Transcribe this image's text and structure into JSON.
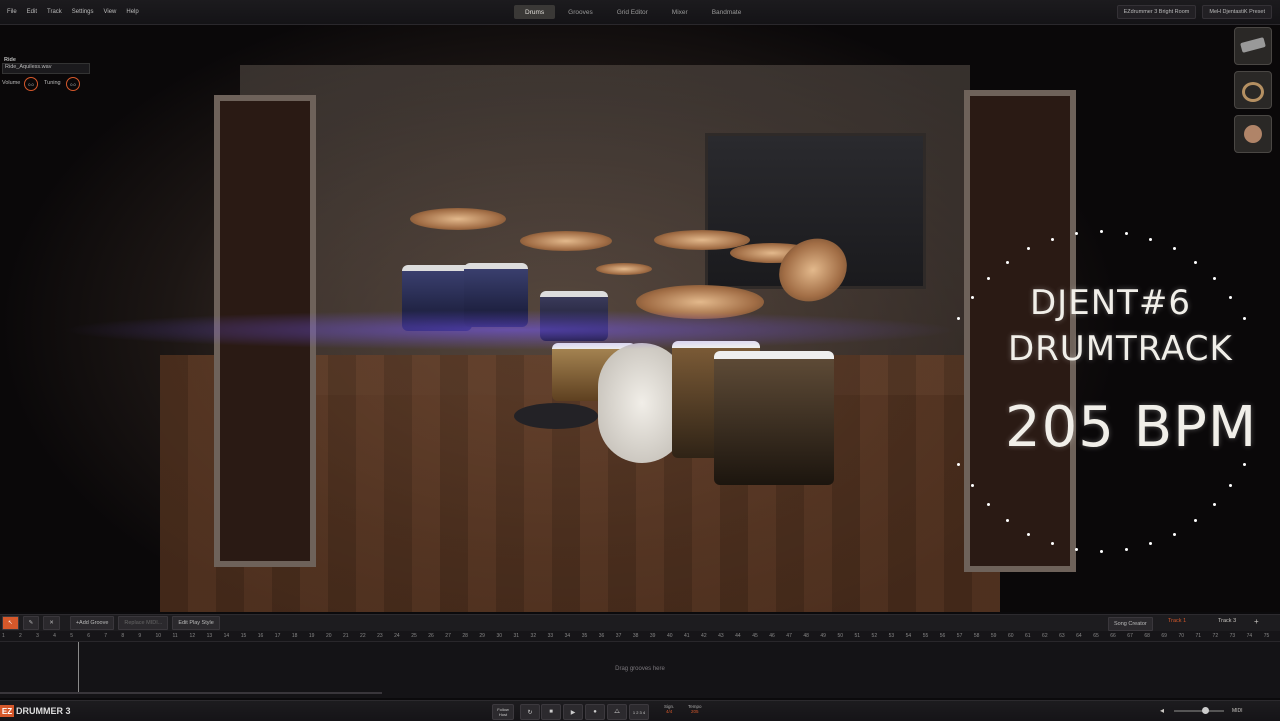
{
  "menu": [
    "File",
    "Edit",
    "Track",
    "Settings",
    "View",
    "Help"
  ],
  "tabs": [
    {
      "label": "Drums",
      "active": true
    },
    {
      "label": "Grooves",
      "active": false
    },
    {
      "label": "Grid Editor",
      "active": false
    },
    {
      "label": "Mixer",
      "active": false
    },
    {
      "label": "Bandmate",
      "active": false
    }
  ],
  "presets": {
    "room": "EZdrummer 3 Bright Room",
    "kit": "MeH DjentastiK Preset"
  },
  "instrument": {
    "name": "Ride",
    "sample": "Ride_Aquiless.wav",
    "volume_label": "Volume",
    "volume_value": "0.0",
    "tuning_label": "Tuning",
    "tuning_value": "0.0"
  },
  "overlay": {
    "line1": "DJENT#6",
    "line2": "DRUMTRACK",
    "bpm": "205 BPM"
  },
  "toolbar": {
    "add_groove": "Add Groove",
    "replace_midi": "Replace MIDI...",
    "edit_play_style": "Edit Play Style"
  },
  "tracks": {
    "track1": "Track 1",
    "track3": "Track 3",
    "song_creator": "Song Creator"
  },
  "timeline": {
    "drag_hint": "Drag grooves here"
  },
  "brand": {
    "logo": "EZ",
    "name": "DRUMMER 3"
  },
  "transport": {
    "follow_host": "Follow Host",
    "time_sig_label": "Sign.",
    "time_sig": "4/4",
    "tempo_label": "Tempo",
    "tempo": "205",
    "count_in": "1 2 3 4",
    "midi_label": "MIDI"
  },
  "colors": {
    "accent": "#d5582b",
    "flare": "#6a4cff"
  }
}
